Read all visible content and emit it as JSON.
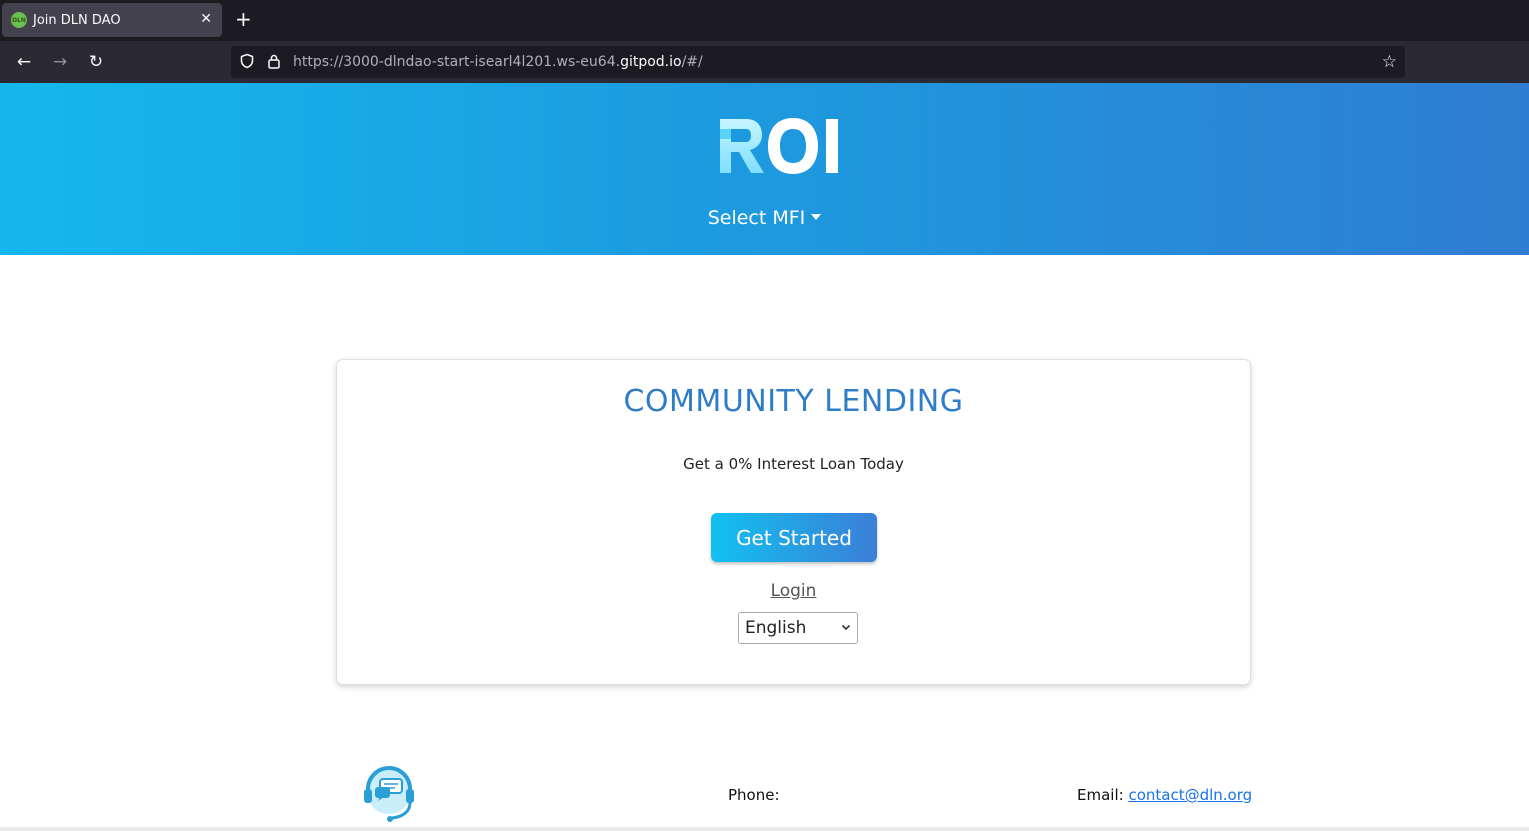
{
  "browser": {
    "tab_title": "Join DLN DAO",
    "favicon_text": "DLN",
    "url_prefix": "https://3000-dlndao-start-isearl4l201.ws-eu64.",
    "url_host": "gitpod.io",
    "url_suffix": "/#/"
  },
  "header": {
    "logo_text": "ROI",
    "select_mfi_label": "Select MFI",
    "gradient_colors": [
      "#15b7ee",
      "#2f7dd2"
    ]
  },
  "card": {
    "title": "COMMUNITY LENDING",
    "subtitle": "Get a 0% Interest Loan Today",
    "get_started_label": "Get Started",
    "login_label": "Login",
    "language_selected": "English",
    "title_color": "#2f7dc8"
  },
  "footer": {
    "phone_label": "Phone:",
    "email_label": "Email:",
    "email_value": "contact@dln.org",
    "support_icon": "headset-chat-icon"
  }
}
